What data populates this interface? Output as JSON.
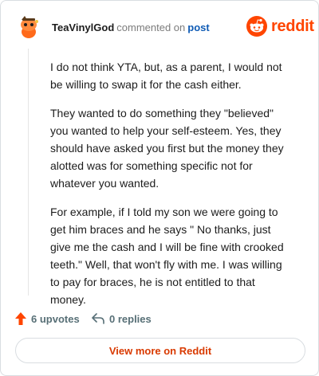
{
  "header": {
    "username": "TeaVinylGod",
    "action": "commented on",
    "post_link": "post",
    "logo_text": "reddit",
    "avatar_icon": "snoo-avatar-icon",
    "logo_icon": "reddit-alien-icon"
  },
  "comment": {
    "paragraphs": [
      "I do not think YTA, but, as a parent, I would not be willing to swap it for the cash either.",
      "They wanted to do something they \"believed\" you wanted to help your self-esteem. Yes, they should have asked you first but the money they alotted was for something specific not for whatever you wanted.",
      "For example, if I told my son we were going to get him braces and he says \" No thanks, just give me the cash and I will be fine with crooked teeth.\" Well, that won't fly with me. I was willing to pay for braces, he is not entitled to that money."
    ]
  },
  "footer": {
    "upvotes": "6 upvotes",
    "replies": "0 replies",
    "upvote_icon": "upvote-arrow-icon",
    "reply_icon": "reply-arrow-icon"
  },
  "view_more": "View more on Reddit",
  "colors": {
    "brand": "#ff4500",
    "link": "#0f5bb5",
    "view_more_text": "#d93a00",
    "muted": "#576f76"
  }
}
